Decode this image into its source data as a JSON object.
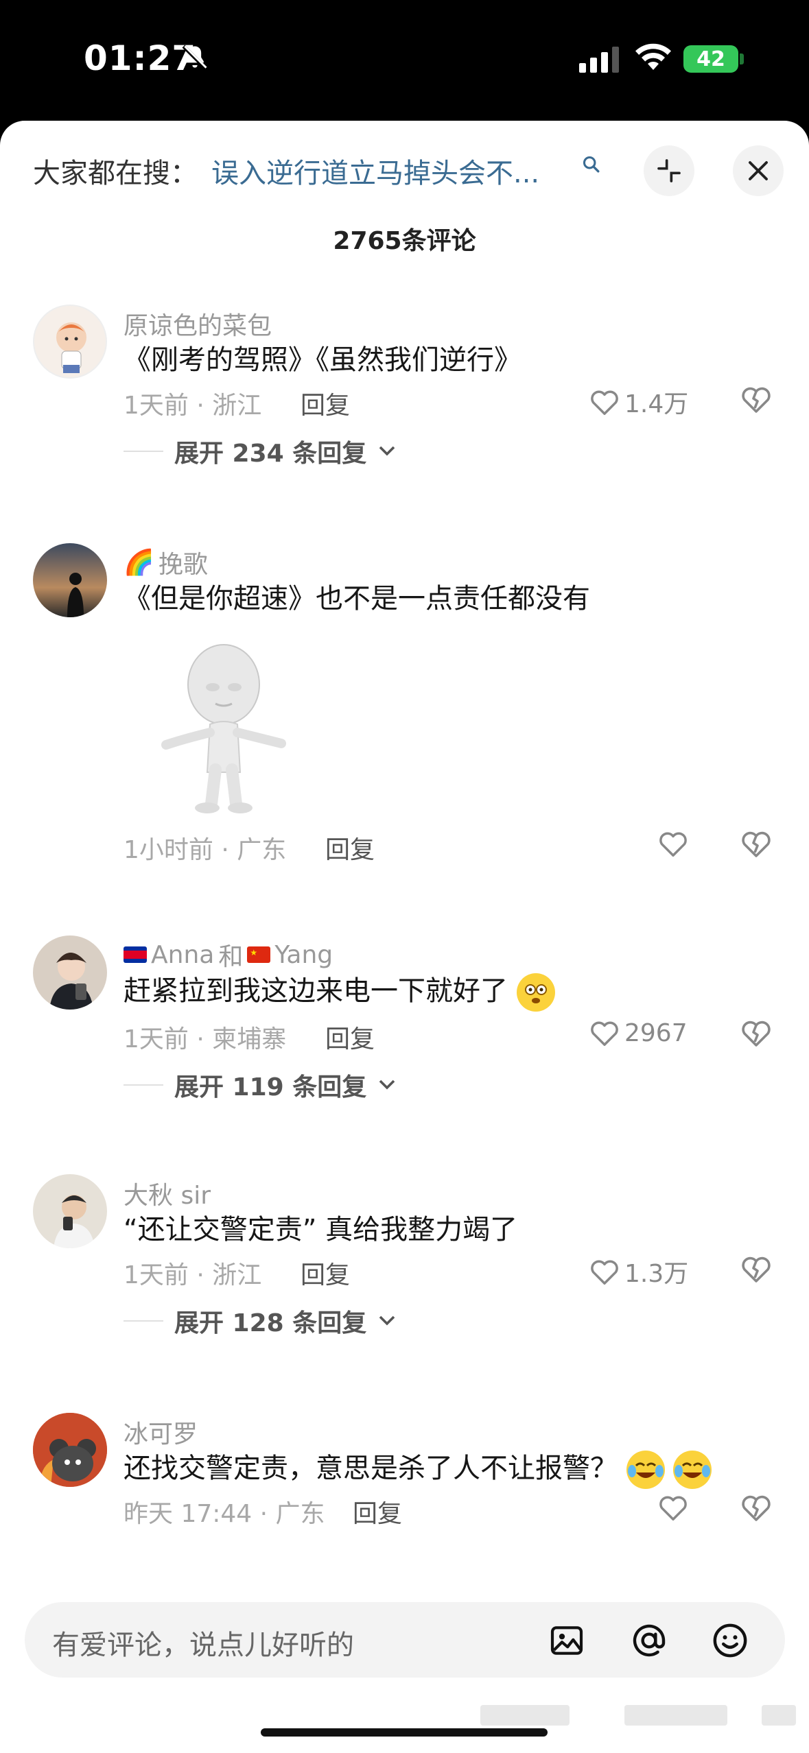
{
  "status_bar": {
    "time": "01:27",
    "battery": "42"
  },
  "search": {
    "prefix": "大家都在搜：",
    "query": "误入逆行道立马掉头会不..."
  },
  "comment_count": "2765条评论",
  "comments": [
    {
      "user": "原谅色的菜包",
      "text": "《刚考的驾照》《虽然我们逆行》",
      "meta": "1天前 · 浙江",
      "reply": "回复",
      "likes": "1.4万",
      "expand": "展开 234 条回复"
    },
    {
      "user": "挽歌",
      "user_prefix_emoji": "🌈",
      "text": "《但是你超速》也不是一点责任都没有",
      "meta": "1小时前 · 广东",
      "reply": "回复",
      "likes": ""
    },
    {
      "user_part1": "Anna",
      "user_join": "和",
      "user_part2": "Yang",
      "text": "赶紧拉到我这边来电一下就好了",
      "meta": "1天前 · 柬埔寨",
      "reply": "回复",
      "likes": "2967",
      "expand": "展开 119 条回复"
    },
    {
      "user": "大秋 sir",
      "text": "“还让交警定责” 真给我整力竭了",
      "meta": "1天前 · 浙江",
      "reply": "回复",
      "likes": "1.3万",
      "expand": "展开 128 条回复"
    },
    {
      "user": "冰可罗",
      "text": "还找交警定责，意思是杀了人不让报警？",
      "meta": "昨天 17:44 · 广东",
      "reply": "回复",
      "likes": ""
    }
  ],
  "input": {
    "placeholder": "有爱评论，说点儿好听的"
  },
  "colors": {
    "link": "#3a6b92",
    "battery": "#34c759",
    "text": "#161616",
    "meta": "#a8a8a8"
  }
}
